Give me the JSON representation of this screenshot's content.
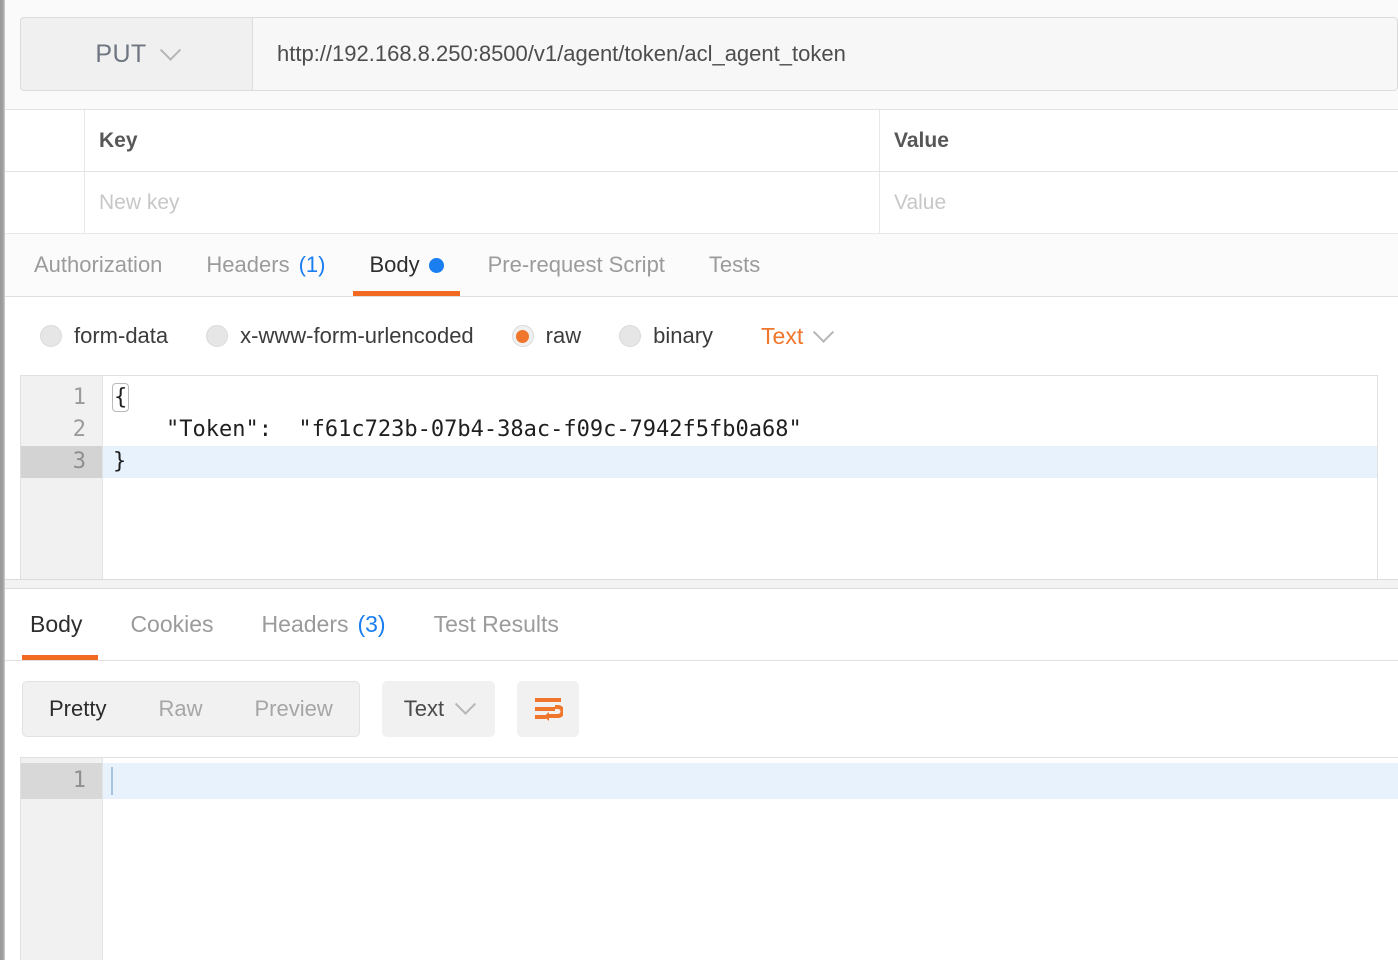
{
  "colors": {
    "accent_orange": "#f26a21",
    "link_blue": "#1a7ef0",
    "radio_orange": "#f0762b",
    "active_line": "#e8f2fc"
  },
  "request": {
    "method": "PUT",
    "method_chevron_icon": "chevron-down-icon",
    "url": "http://192.168.8.250:8500/v1/agent/token/acl_agent_token",
    "url_placeholder": "Enter request URL"
  },
  "params_table": {
    "headers": {
      "key": "Key",
      "value": "Value"
    },
    "new_row": {
      "key_placeholder": "New key",
      "value_placeholder": "Value"
    }
  },
  "request_tabs": [
    {
      "label": "Authorization",
      "count": "",
      "active": false,
      "dot": false
    },
    {
      "label": "Headers",
      "count": "(1)",
      "active": false,
      "dot": false
    },
    {
      "label": "Body",
      "count": "",
      "active": true,
      "dot": true
    },
    {
      "label": "Pre-request Script",
      "count": "",
      "active": false,
      "dot": false
    },
    {
      "label": "Tests",
      "count": "",
      "active": false,
      "dot": false
    }
  ],
  "body_types": [
    {
      "label": "form-data",
      "selected": false
    },
    {
      "label": "x-www-form-urlencoded",
      "selected": false
    },
    {
      "label": "raw",
      "selected": true
    },
    {
      "label": "binary",
      "selected": false
    }
  ],
  "body_language": {
    "label": "Text",
    "chevron_icon": "chevron-down-icon"
  },
  "request_body": {
    "lines": [
      {
        "number": "1",
        "text": "{",
        "active": false,
        "bracket": true
      },
      {
        "number": "2",
        "text": "    \"Token\":  \"f61c723b-07b4-38ac-f09c-7942f5fb0a68\"",
        "active": false,
        "bracket": false
      },
      {
        "number": "3",
        "text": "}",
        "active": true,
        "bracket": false
      }
    ],
    "token_value": "f61c723b-07b4-38ac-f09c-7942f5fb0a68",
    "token_key": "Token"
  },
  "response_tabs": [
    {
      "label": "Body",
      "count": "",
      "active": true
    },
    {
      "label": "Cookies",
      "count": "",
      "active": false
    },
    {
      "label": "Headers",
      "count": "(3)",
      "active": false
    },
    {
      "label": "Test Results",
      "count": "",
      "active": false
    }
  ],
  "response_toolbar": {
    "views": [
      {
        "label": "Pretty",
        "active": true
      },
      {
        "label": "Raw",
        "active": false
      },
      {
        "label": "Preview",
        "active": false
      }
    ],
    "format": {
      "label": "Text",
      "chevron_icon": "chevron-down-icon"
    },
    "wrap_button_icon": "word-wrap-icon"
  },
  "response_body": {
    "lines": [
      {
        "number": "1",
        "text": "",
        "active": true
      }
    ]
  }
}
